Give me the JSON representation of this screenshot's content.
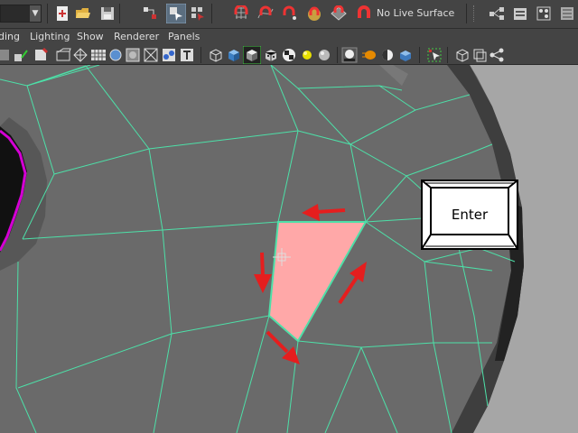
{
  "shelf": {
    "live_surface_label": "No Live Surface"
  },
  "menubar": {
    "items": [
      "ding",
      "Lighting",
      "Show",
      "Renderer",
      "Panels"
    ]
  },
  "overlay": {
    "enter_key_label": "Enter"
  },
  "colors": {
    "ui_background": "#444444",
    "mesh_face": "#6b6b6b",
    "wire_edge": "#4de0a8",
    "selected_face": "#ffa8a8",
    "annotation_arrow": "#e51e1e",
    "border_edge": "#d400d4"
  }
}
